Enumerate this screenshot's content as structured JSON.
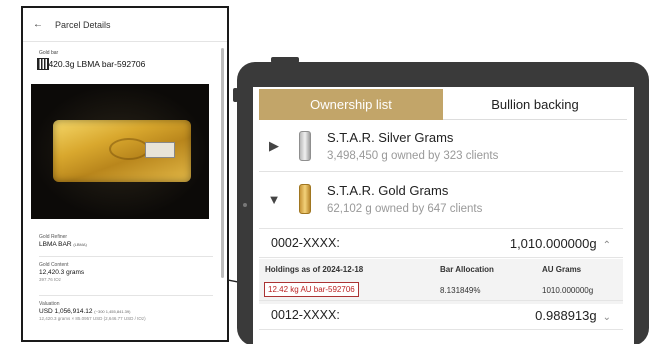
{
  "phone": {
    "header_title": "Parcel Details",
    "kind_label": "Gold bar",
    "bar_title": "12420.3g LBMA bar-592706",
    "refiner_label": "Gold Refiner",
    "refiner_value": "LBMA BAR",
    "refiner_tag": "(LBMA)",
    "content_label": "Gold Content",
    "content_value": "12,420.3 grams",
    "content_sub": "397.76 tOz",
    "valuation_label": "Valuation",
    "valuation_value": "USD 1,056,914.12",
    "valuation_rate": "(~300 1,455,841.39)",
    "valuation_sub": "12,420.3 grams × 85.0957 USD (2,646.77 USD / tOz)"
  },
  "tablet": {
    "tabs": [
      {
        "label": "Ownership list",
        "active": true
      },
      {
        "label": "Bullion backing",
        "active": false
      }
    ],
    "products": [
      {
        "name": "S.T.A.R. Silver Grams",
        "summary": "3,498,450 g owned by 323 clients",
        "expanded": false,
        "metal": "silver"
      },
      {
        "name": "S.T.A.R. Gold Grams",
        "summary": "62,102 g owned by 647 clients",
        "expanded": true,
        "metal": "gold"
      }
    ],
    "accounts": [
      {
        "id": "0002-XXXX:",
        "amount": "1,010.000000g",
        "expanded": true
      },
      {
        "id": "0012-XXXX:",
        "amount": "0.988913g",
        "expanded": false
      }
    ],
    "holdings": {
      "header_label": "Holdings as of 2024-12-18",
      "col_allocation": "Bar Allocation",
      "col_au": "AU Grams",
      "row": {
        "bar": "12.42 kg AU bar-592706",
        "allocation": "8.131849%",
        "au_grams": "1010.000000g"
      }
    }
  },
  "colors": {
    "accent_gold": "#c2a569",
    "link_red": "#b22222"
  }
}
